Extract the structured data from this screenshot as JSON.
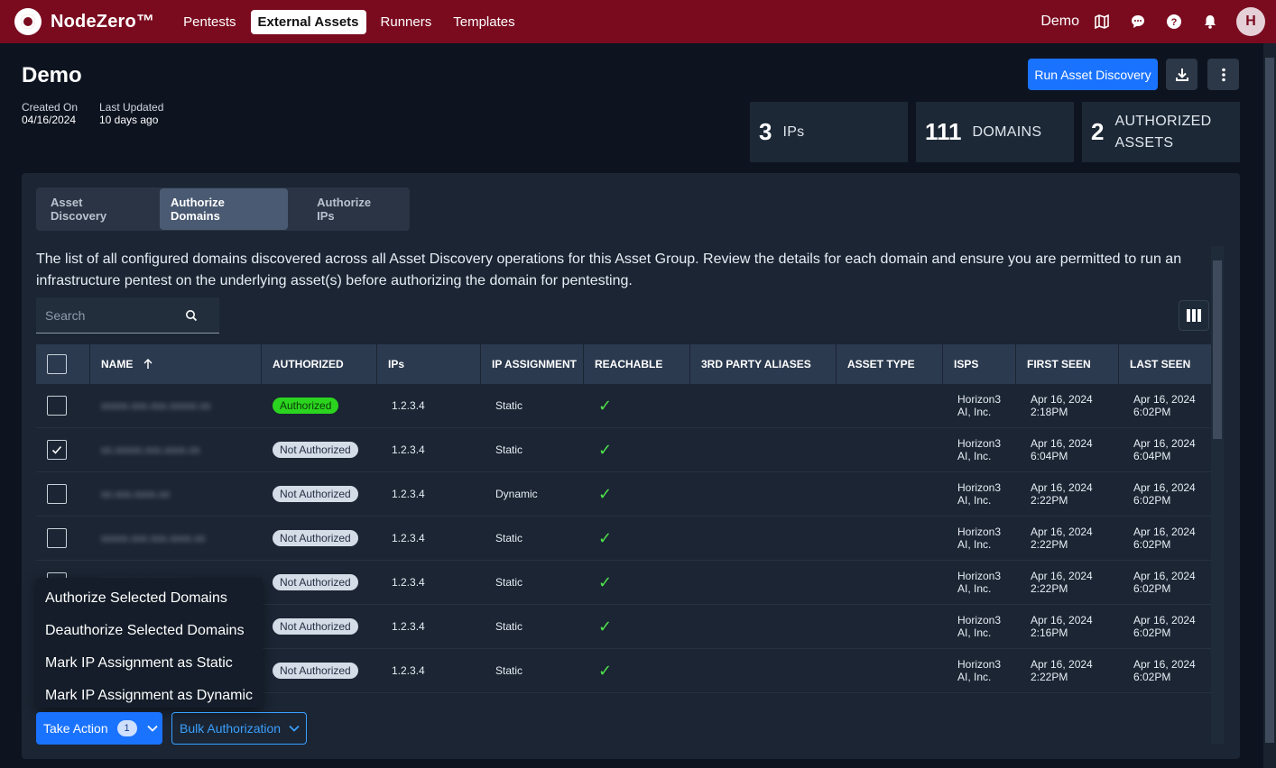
{
  "app": {
    "name": "NodeZero™",
    "nav": [
      "Pentests",
      "External Assets",
      "Runners",
      "Templates"
    ],
    "active_nav": 1,
    "org": "Demo",
    "avatar_initial": "H"
  },
  "header": {
    "title": "Demo",
    "created_label": "Created On",
    "created_value": "04/16/2024",
    "updated_label": "Last Updated",
    "updated_value": "10 days ago",
    "run_button": "Run Asset Discovery"
  },
  "stats": [
    {
      "value": "3",
      "label": "IPs"
    },
    {
      "value": "111",
      "label": "DOMAINS"
    },
    {
      "value": "2",
      "label": "AUTHORIZED ASSETS"
    }
  ],
  "tabs": [
    "Asset Discovery",
    "Authorize Domains",
    "Authorize IPs"
  ],
  "active_tab": 1,
  "description": "The list of all configured domains discovered across all Asset Discovery operations for this Asset Group. Review the details for each domain and ensure you are permitted to run an infrastructure pentest on the underlying asset(s) before authorizing the domain for pentesting.",
  "search": {
    "placeholder": "Search"
  },
  "table": {
    "columns": [
      "NAME",
      "AUTHORIZED",
      "IPs",
      "IP ASSIGNMENT",
      "REACHABLE",
      "3RD PARTY ALIASES",
      "ASSET TYPE",
      "ISPS",
      "FIRST SEEN",
      "LAST SEEN"
    ],
    "rows": [
      {
        "name": "xxxxx.xxx.xxx.xxxxx.xx",
        "checked": false,
        "authorized": "Authorized",
        "ips": "1.2.3.4",
        "assignment": "Static",
        "isp1": "Horizon3",
        "isp2": "AI, Inc.",
        "first1": "Apr 16, 2024",
        "first2": "2:18PM",
        "last1": "Apr 16, 2024",
        "last2": "6:02PM"
      },
      {
        "name": "xx.xxxxx.xxx.xxxx.xx",
        "checked": true,
        "authorized": "Not Authorized",
        "ips": "1.2.3.4",
        "assignment": "Static",
        "isp1": "Horizon3",
        "isp2": "AI, Inc.",
        "first1": "Apr 16, 2024",
        "first2": "6:04PM",
        "last1": "Apr 16, 2024",
        "last2": "6:04PM"
      },
      {
        "name": "xx.xxx.xxxx.xx",
        "checked": false,
        "authorized": "Not Authorized",
        "ips": "1.2.3.4",
        "assignment": "Dynamic",
        "isp1": "Horizon3",
        "isp2": "AI, Inc.",
        "first1": "Apr 16, 2024",
        "first2": "2:22PM",
        "last1": "Apr 16, 2024",
        "last2": "6:02PM"
      },
      {
        "name": "xxxxx.xxx.xxx.xxxx.xx",
        "checked": false,
        "authorized": "Not Authorized",
        "ips": "1.2.3.4",
        "assignment": "Static",
        "isp1": "Horizon3",
        "isp2": "AI, Inc.",
        "first1": "Apr 16, 2024",
        "first2": "2:22PM",
        "last1": "Apr 16, 2024",
        "last2": "6:02PM"
      },
      {
        "name": "xxxxx.xxx.xxxxx.xx",
        "checked": false,
        "authorized": "Not Authorized",
        "ips": "1.2.3.4",
        "assignment": "Static",
        "isp1": "Horizon3",
        "isp2": "AI, Inc.",
        "first1": "Apr 16, 2024",
        "first2": "2:22PM",
        "last1": "Apr 16, 2024",
        "last2": "6:02PM"
      },
      {
        "name": "xxxxx.xxx.xxxx.xx",
        "checked": false,
        "authorized": "Not Authorized",
        "ips": "1.2.3.4",
        "assignment": "Static",
        "isp1": "Horizon3",
        "isp2": "AI, Inc.",
        "first1": "Apr 16, 2024",
        "first2": "2:16PM",
        "last1": "Apr 16, 2024",
        "last2": "6:02PM"
      },
      {
        "name": "xxxxx.xxx.xxxx.xx",
        "checked": false,
        "authorized": "Not Authorized",
        "ips": "1.2.3.4",
        "assignment": "Static",
        "isp1": "Horizon3",
        "isp2": "AI, Inc.",
        "first1": "Apr 16, 2024",
        "first2": "2:22PM",
        "last1": "Apr 16, 2024",
        "last2": "6:02PM"
      }
    ]
  },
  "action_menu": [
    "Authorize Selected Domains",
    "Deauthorize Selected Domains",
    "Mark IP Assignment as Static",
    "Mark IP Assignment as Dynamic"
  ],
  "footer": {
    "take_action": "Take Action",
    "selected_count": "1",
    "bulk": "Bulk Authorization"
  },
  "colors": {
    "brand": "#7a0b1f",
    "primary": "#1a73ff",
    "authorized": "#2bd41f",
    "reachable": "#4ee34a"
  }
}
